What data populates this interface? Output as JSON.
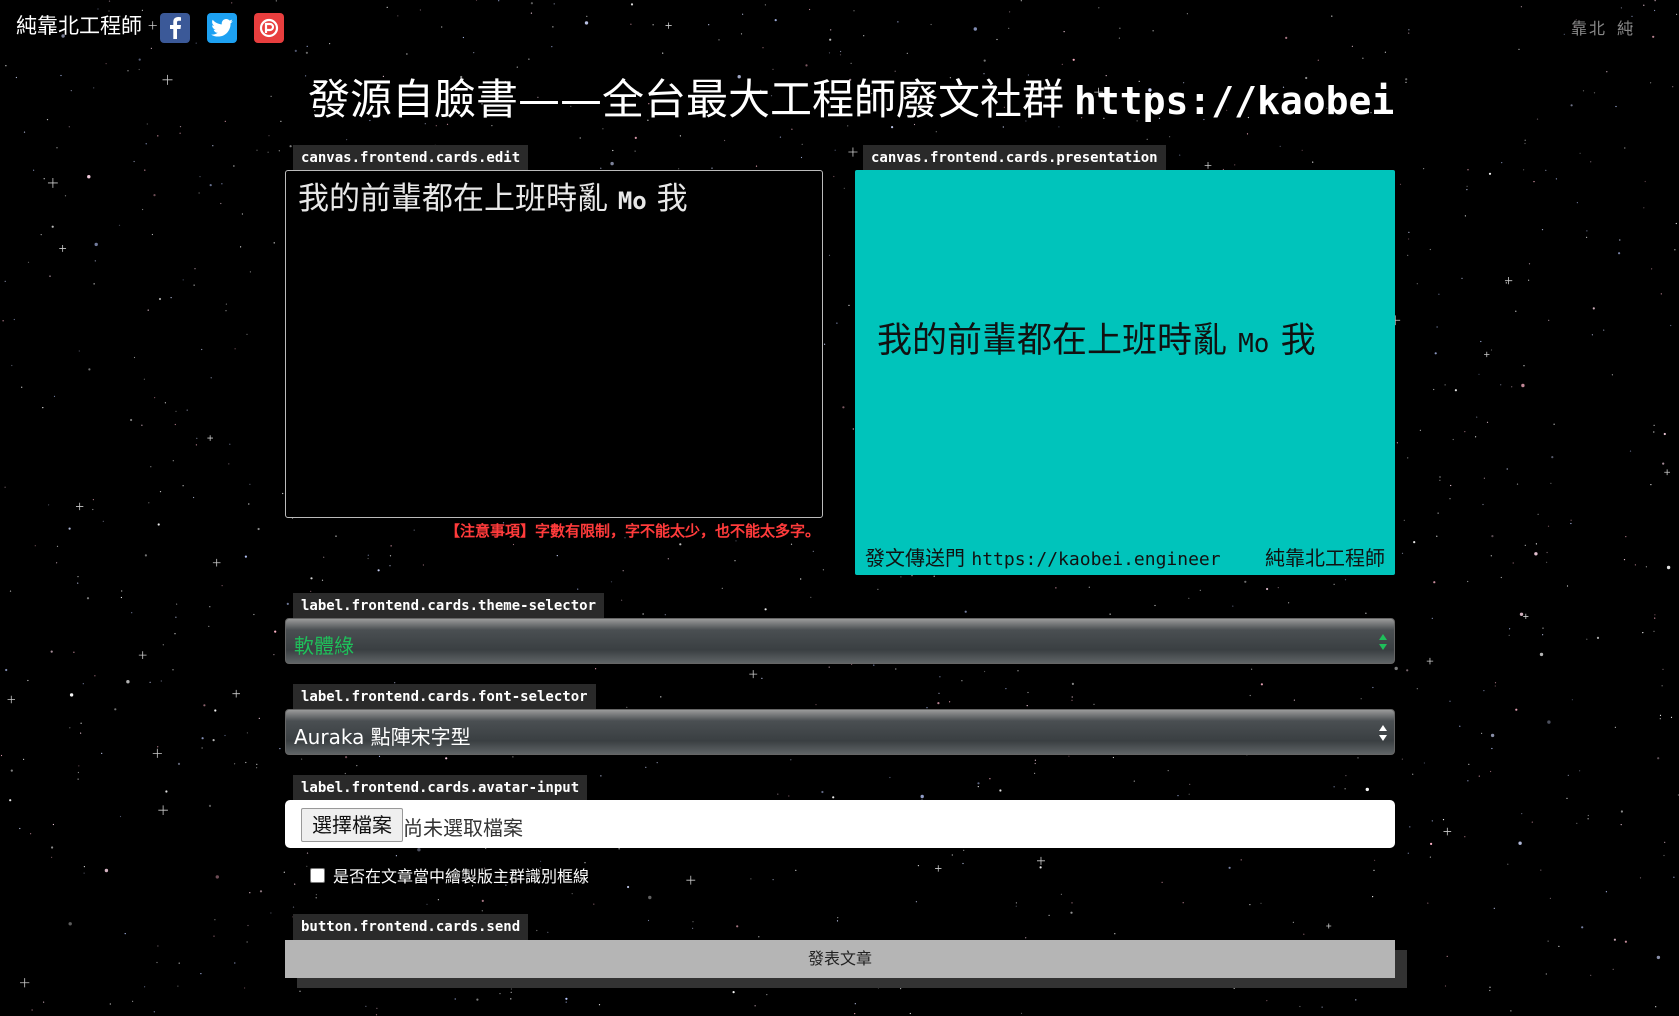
{
  "nav": {
    "brand": "純靠北工程師",
    "social": [
      {
        "name": "facebook",
        "color": "#3b5998"
      },
      {
        "name": "twitter",
        "color": "#1da1f2"
      },
      {
        "name": "plurk",
        "color": "#e83e3e"
      }
    ],
    "right_links": [
      "靠北",
      "純"
    ]
  },
  "headline": {
    "text": "發源自臉書——全台最大工程師廢文社群",
    "url": "https://kaobei.e"
  },
  "editor": {
    "label": "canvas.frontend.cards.edit",
    "content_text": "我的前輩都在上班時亂",
    "content_mono": "Mo",
    "content_tail": "我",
    "notice": "【注意事項】字數有限制，字不能太少，也不能太多字。"
  },
  "preview": {
    "label": "canvas.frontend.cards.presentation",
    "background": "#00c4bb",
    "text": "我的前輩都在上班時亂",
    "text_mono": "Mo",
    "text_tail": "我",
    "footer_left": "發文傳送門",
    "footer_url": "https://kaobei.engineer",
    "footer_right": "純靠北工程師"
  },
  "theme_selector": {
    "label": "label.frontend.cards.theme-selector",
    "value": "軟體綠",
    "value_color": "#1fbf5a"
  },
  "font_selector": {
    "label": "label.frontend.cards.font-selector",
    "value": "Auraka 點陣宋字型"
  },
  "avatar_input": {
    "label": "label.frontend.cards.avatar-input",
    "button": "選擇檔案",
    "filename": "尚未選取檔案"
  },
  "checkbox": {
    "label": "是否在文章當中繪製版主群識別框線",
    "checked": false
  },
  "send": {
    "label": "button.frontend.cards.send",
    "button": "發表文章"
  }
}
